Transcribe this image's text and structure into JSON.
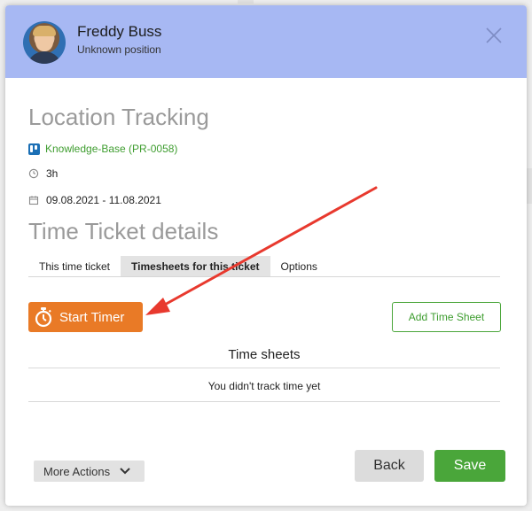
{
  "header": {
    "user_name": "Freddy Buss",
    "user_position": "Unknown position",
    "header_color": "#a7b8f3"
  },
  "ticket": {
    "title": "Location Tracking",
    "project_icon": "trello-board-icon",
    "project_link": "Knowledge-Base (PR-0058)",
    "duration_icon": "clock-icon",
    "duration": "3h",
    "date_icon": "calendar-icon",
    "date_range": "09.08.2021 - 11.08.2021"
  },
  "details": {
    "heading": "Time Ticket details",
    "tabs": [
      {
        "label": "This time ticket",
        "active": false
      },
      {
        "label": "Timesheets for this ticket",
        "active": true
      },
      {
        "label": "Options",
        "active": false
      }
    ]
  },
  "timesheets": {
    "start_timer_label": "Start Timer",
    "start_timer_icon": "stopwatch-icon",
    "add_time_sheet_label": "Add Time Sheet",
    "section_title": "Time sheets",
    "empty_message": "You didn't track time yet"
  },
  "footer": {
    "more_actions_label": "More Actions",
    "back_label": "Back",
    "save_label": "Save"
  },
  "colors": {
    "accent_orange": "#e97a26",
    "accent_green": "#4aa63a",
    "annotation_arrow": "#e8392e"
  }
}
